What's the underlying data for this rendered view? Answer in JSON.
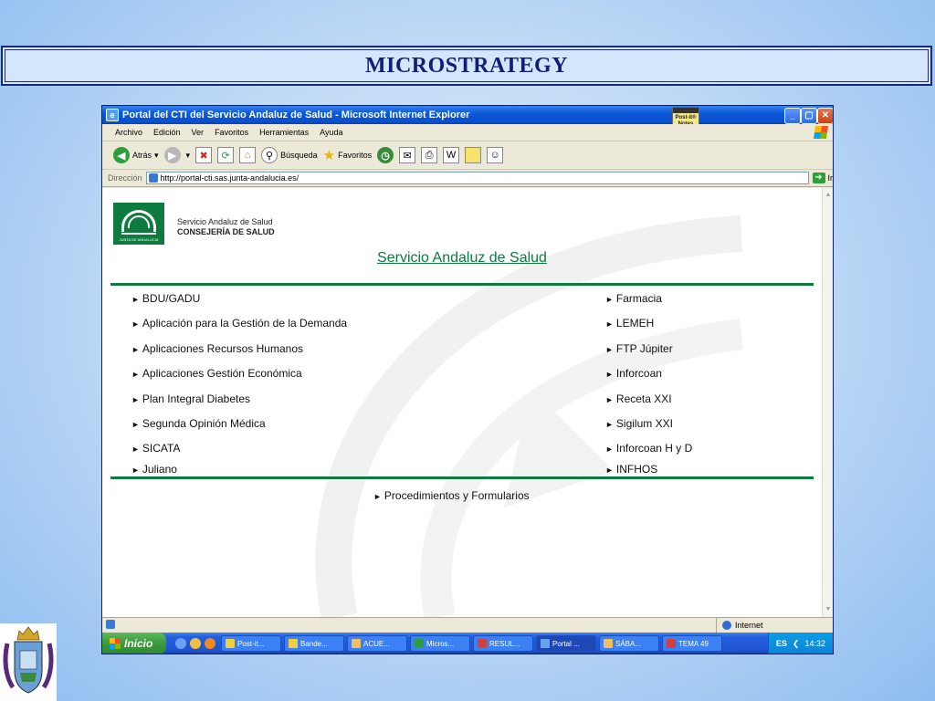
{
  "slide": {
    "title": "MICROSTRATEGY"
  },
  "window": {
    "title": "Portal del CTI del Servicio Andaluz de Salud - Microsoft Internet Explorer",
    "postit_label": "Post-it® Notes",
    "menu": [
      "Archivo",
      "Edición",
      "Ver",
      "Favoritos",
      "Herramientas",
      "Ayuda"
    ],
    "toolbar": {
      "back": "Atrás",
      "search": "Búsqueda",
      "favorites": "Favoritos"
    },
    "address": {
      "label": "Dirección",
      "url": "http://portal-cti.sas.junta-andalucia.es/",
      "go": "Ir"
    }
  },
  "page": {
    "org_line1": "Servicio Andaluz de Salud",
    "org_line2": "CONSEJERÍA DE SALUD",
    "logo_text": "JUNTA DE ANDALUCIA",
    "heading": "Servicio Andaluz de Salud",
    "links_left": [
      "BDU/GADU",
      "Aplicación para la Gestión de la Demanda",
      "Aplicaciones Recursos Humanos",
      "Aplicaciones Gestión Económica",
      "Plan Integral Diabetes",
      "Segunda Opinión Médica",
      "SICATA",
      "Juliano"
    ],
    "links_right": [
      "Farmacia",
      "LEMEH",
      "FTP Júpiter",
      "Inforcoan",
      "Receta XXI",
      "Sigilum XXI",
      "Inforcoan H y D",
      "INFHOS"
    ],
    "bottom_link": "Procedimientos y Formularios"
  },
  "statusbar": {
    "zone": "Internet"
  },
  "taskbar": {
    "start": "Inicio",
    "tasks": [
      "Post-it...",
      "Bande...",
      "ACUE...",
      "Micros...",
      "RESUL...",
      "Portal ...",
      "SÁBA...",
      "TEMA 49"
    ],
    "active_index": 5,
    "lang": "ES",
    "clock": "14:32"
  },
  "colors": {
    "sas_green": "#0d7a3e",
    "title_navy": "#0f1f7a"
  }
}
